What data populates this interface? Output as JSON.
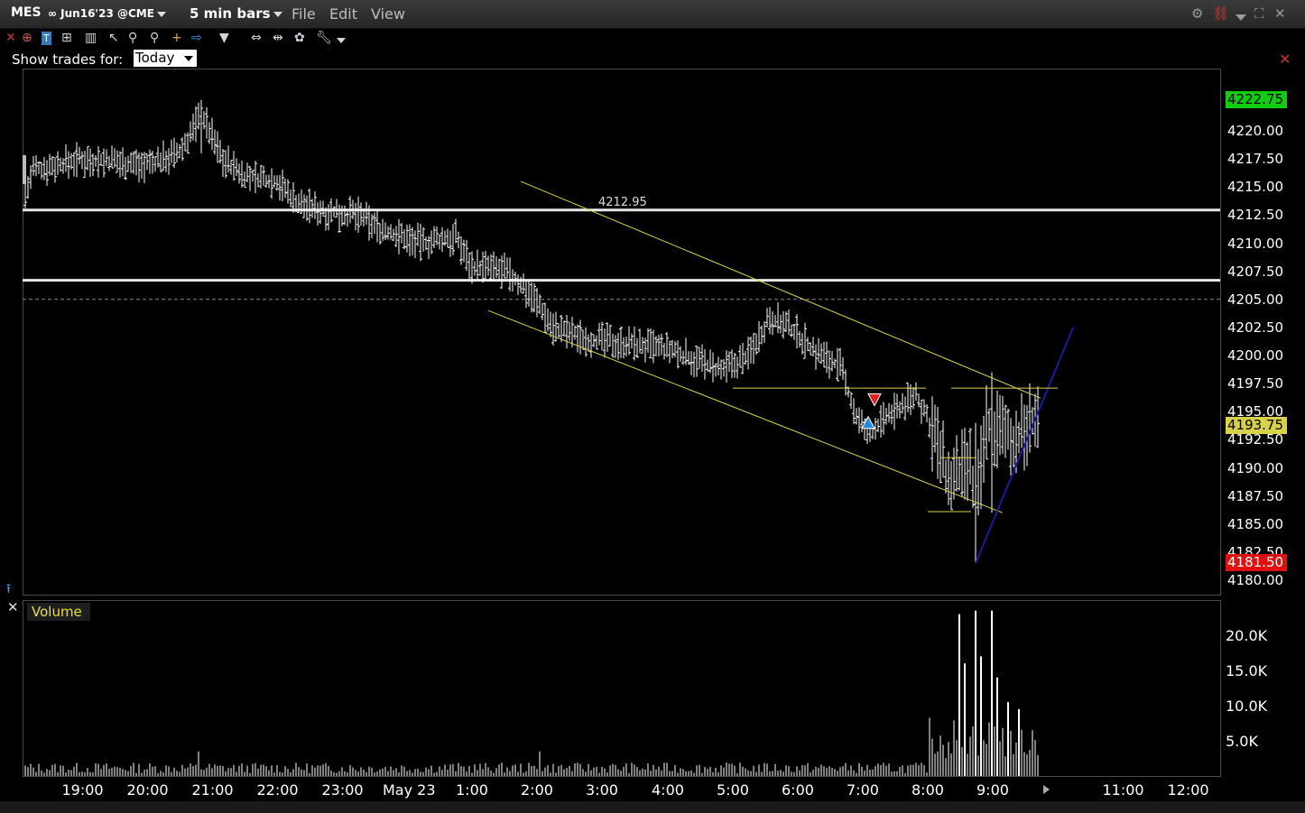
{
  "title_bar": {
    "symbol": "MES",
    "contract": "∞ Jun16'23 @CME",
    "interval": "5 min bars",
    "menus": [
      "File",
      "Edit",
      "View"
    ]
  },
  "toolbar": {
    "icons": [
      "close-icon",
      "crosshair-icon",
      "text-icon",
      "indicator-icon",
      "bar-chart-icon",
      "cursor-icon",
      "zoom-in-icon",
      "zoom-out-icon",
      "crosshair-plus-icon",
      "arrow-right-icon",
      "filter-icon",
      "expand-horizontal-icon",
      "fit-icon",
      "palette-icon",
      "wrench-icon",
      "dropdown-icon"
    ]
  },
  "trades_filter": {
    "label": "Show trades for:",
    "value": "Today"
  },
  "price_axis": {
    "ticks": [
      "4220.00",
      "4217.50",
      "4215.00",
      "4212.50",
      "4210.00",
      "4207.50",
      "4205.00",
      "4202.50",
      "4200.00",
      "4197.50",
      "4195.00",
      "4192.50",
      "4190.00",
      "4187.50",
      "4185.00",
      "4182.50",
      "4180.00"
    ],
    "high": "4222.75",
    "last": "4193.75",
    "low": "4181.50"
  },
  "level_label": "4212.95",
  "time_axis": [
    "19:00",
    "20:00",
    "21:00",
    "22:00",
    "23:00",
    "May 23",
    "1:00",
    "2:00",
    "3:00",
    "4:00",
    "5:00",
    "6:00",
    "7:00",
    "8:00",
    "9:00",
    "11:00",
    "12:00"
  ],
  "volume_pane": {
    "label": "Volume",
    "ticks": [
      "20.0K",
      "15.0K",
      "10.0K",
      "5.0K"
    ]
  },
  "colors": {
    "background": "#000000",
    "bars": "#ffffff",
    "trendline": "#d8d24a",
    "support_line": "#1a1aa0",
    "volume_label": "#e8e030",
    "high_flag": "#11cc11",
    "low_flag": "#e01010",
    "last_flag": "#d8d24a"
  },
  "chart_data": {
    "type": "ohlc",
    "interval_minutes": 5,
    "price_range": [
      4180,
      4224
    ],
    "volume_range": [
      0,
      25000
    ],
    "session_high": 4222.75,
    "session_low": 4181.5,
    "last": 4193.75,
    "horizontal_levels": [
      4212.95,
      4206.7
    ],
    "dashed_level": 4205.0,
    "channel_upper": [
      {
        "time": "1:45",
        "price": 4215.5
      },
      {
        "time": "9:45",
        "price": 4196.2
      }
    ],
    "channel_lower": [
      {
        "time": "1:15",
        "price": 4204.0
      },
      {
        "time": "9:10",
        "price": 4186.0
      }
    ],
    "support_line": [
      {
        "time": "8:45",
        "price": 4181.5
      },
      {
        "time": "10:15",
        "price": 4202.5
      }
    ],
    "anchors": [
      {
        "time": "18:00",
        "price": 4212.0
      },
      {
        "time": "18:15",
        "price": 4216.5
      },
      {
        "time": "19:00",
        "price": 4217.5
      },
      {
        "time": "20:00",
        "price": 4217.0
      },
      {
        "time": "20:30",
        "price": 4218.0
      },
      {
        "time": "20:50",
        "price": 4221.5
      },
      {
        "time": "21:10",
        "price": 4217.5
      },
      {
        "time": "21:30",
        "price": 4216.0
      },
      {
        "time": "22:00",
        "price": 4215.5
      },
      {
        "time": "22:20",
        "price": 4213.5
      },
      {
        "time": "22:45",
        "price": 4212.8
      },
      {
        "time": "23:15",
        "price": 4212.5
      },
      {
        "time": "23:40",
        "price": 4211.0
      },
      {
        "time": "0:15",
        "price": 4210.0
      },
      {
        "time": "0:45",
        "price": 4210.5
      },
      {
        "time": "1:00",
        "price": 4208.0
      },
      {
        "time": "1:30",
        "price": 4207.5
      },
      {
        "time": "1:55",
        "price": 4205.5
      },
      {
        "time": "2:15",
        "price": 4202.5
      },
      {
        "time": "2:45",
        "price": 4201.5
      },
      {
        "time": "3:30",
        "price": 4201.0
      },
      {
        "time": "4:00",
        "price": 4200.5
      },
      {
        "time": "4:30",
        "price": 4199.5
      },
      {
        "time": "4:50",
        "price": 4198.5
      },
      {
        "time": "5:15",
        "price": 4200.0
      },
      {
        "time": "5:35",
        "price": 4203.5
      },
      {
        "time": "6:00",
        "price": 4202.0
      },
      {
        "time": "6:15",
        "price": 4200.5
      },
      {
        "time": "6:40",
        "price": 4199.0
      },
      {
        "time": "6:55",
        "price": 4194.5
      },
      {
        "time": "7:05",
        "price": 4193.0
      },
      {
        "time": "7:30",
        "price": 4195.0
      },
      {
        "time": "7:50",
        "price": 4196.5
      },
      {
        "time": "8:05",
        "price": 4193.5
      },
      {
        "time": "8:20",
        "price": 4188.5
      },
      {
        "time": "8:40",
        "price": 4190.0
      },
      {
        "time": "8:45",
        "price": 4186.0
      },
      {
        "time": "8:55",
        "price": 4194.0
      },
      {
        "time": "9:10",
        "price": 4193.0
      },
      {
        "time": "9:25",
        "price": 4192.5
      },
      {
        "time": "9:40",
        "price": 4194.5
      }
    ],
    "volume_spikes": [
      {
        "time": "8:30",
        "value": 23000
      },
      {
        "time": "8:45",
        "value": 23500
      },
      {
        "time": "9:00",
        "value": 23500
      },
      {
        "time": "8:35",
        "value": 16000
      },
      {
        "time": "8:50",
        "value": 17000
      },
      {
        "time": "9:05",
        "value": 14000
      },
      {
        "time": "9:15",
        "value": 10500
      },
      {
        "time": "9:25",
        "value": 9500
      }
    ]
  }
}
